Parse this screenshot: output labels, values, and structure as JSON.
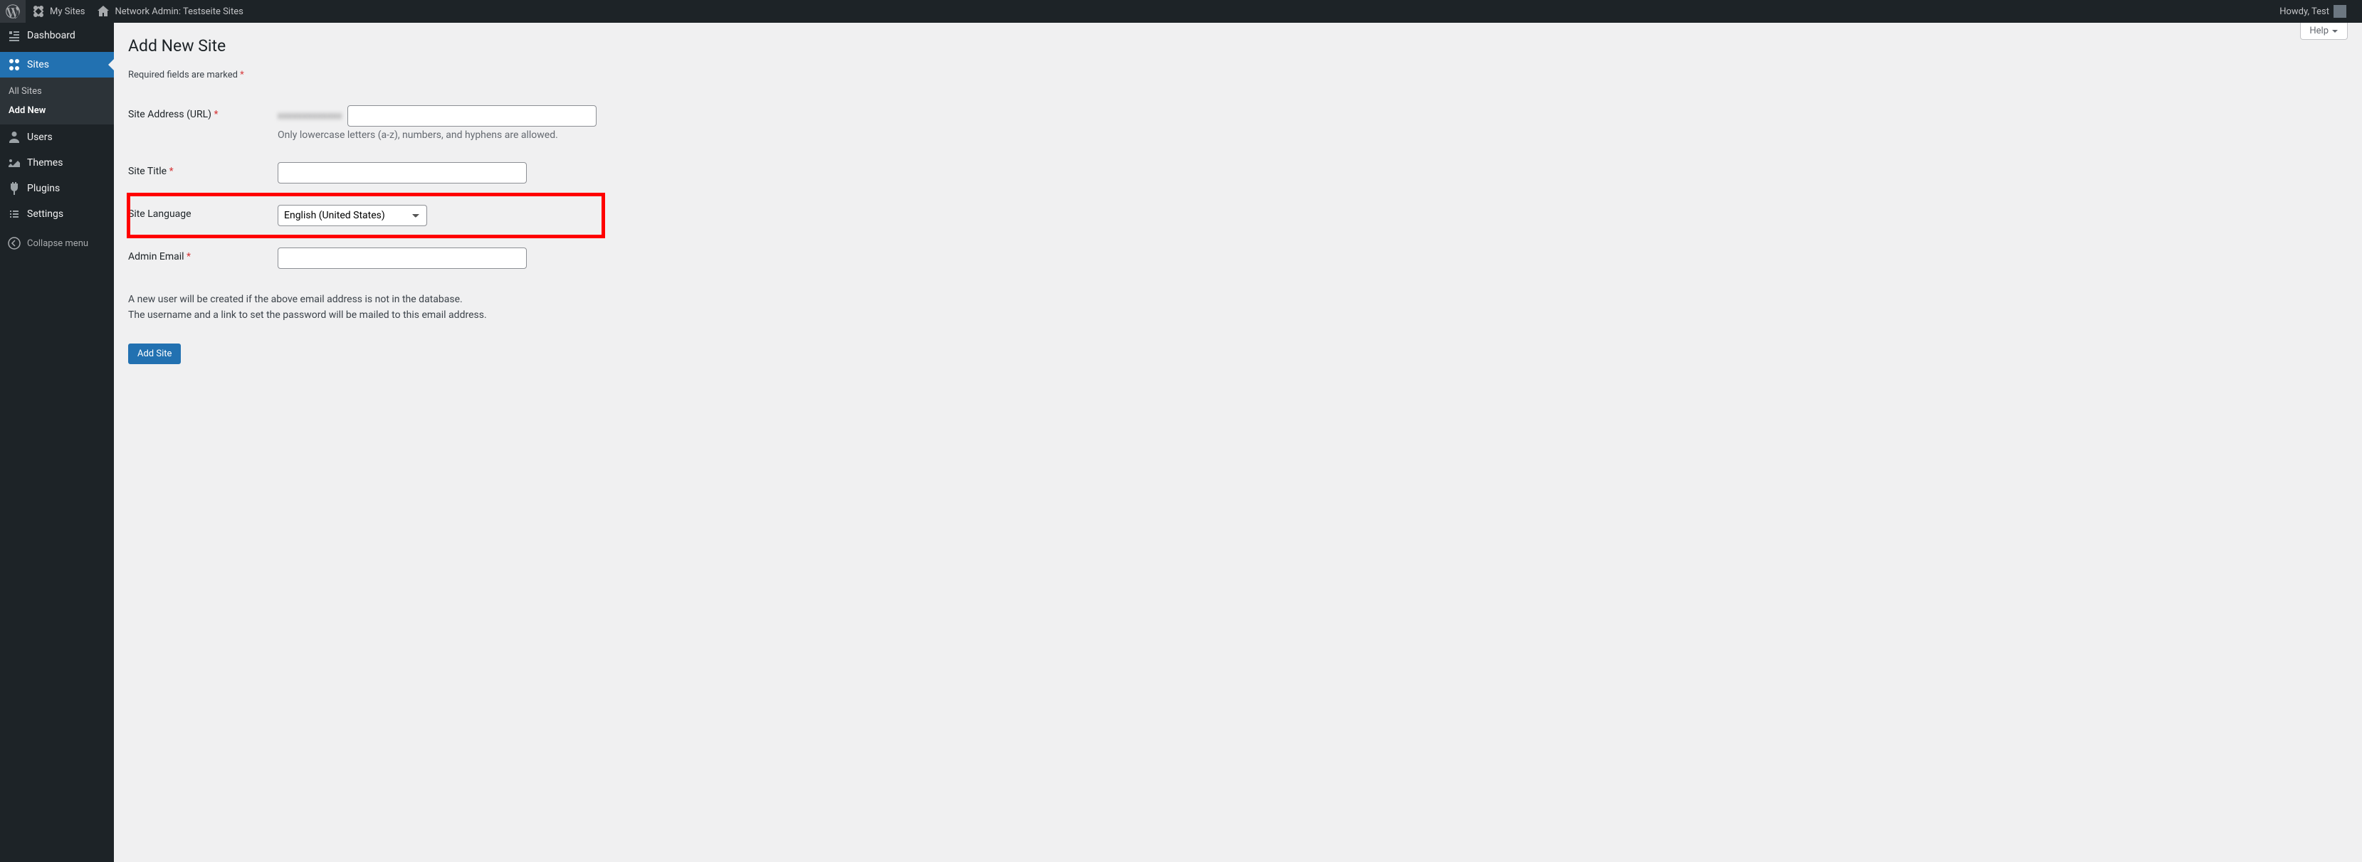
{
  "adminbar": {
    "my_sites": "My Sites",
    "network_admin": "Network Admin: Testseite Sites",
    "howdy": "Howdy, Test"
  },
  "sidebar": {
    "dashboard": "Dashboard",
    "sites": "Sites",
    "all_sites": "All Sites",
    "add_new": "Add New",
    "users": "Users",
    "themes": "Themes",
    "plugins": "Plugins",
    "settings": "Settings",
    "collapse": "Collapse menu"
  },
  "page": {
    "title": "Add New Site",
    "help_label": "Help",
    "required_note": "Required fields are marked ",
    "submit": "Add Site"
  },
  "form": {
    "site_address": {
      "label": "Site Address (URL) ",
      "prefix_masked": "xxxxxxxxxxxxx",
      "value": "",
      "hint": "Only lowercase letters (a-z), numbers, and hyphens are allowed."
    },
    "site_title": {
      "label": "Site Title ",
      "value": ""
    },
    "site_language": {
      "label": "Site Language",
      "value": "English (United States)"
    },
    "admin_email": {
      "label": "Admin Email ",
      "value": ""
    }
  },
  "help_text": {
    "line1": "A new user will be created if the above email address is not in the database.",
    "line2": "The username and a link to set the password will be mailed to this email address."
  }
}
